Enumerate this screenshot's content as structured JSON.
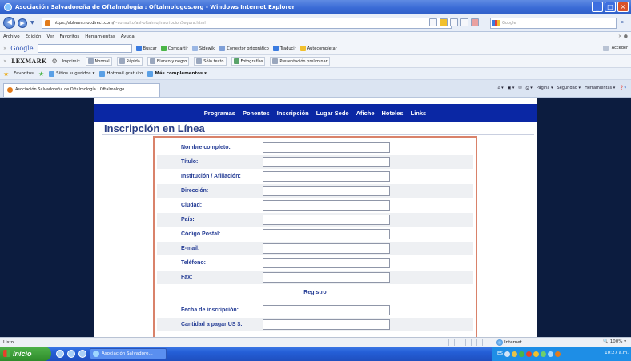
{
  "window": {
    "title": "Asociación Salvadoreña de Oftalmología : Oftalmologos.org - Windows Internet Explorer",
    "controls": [
      "_",
      "□",
      "×"
    ]
  },
  "address": {
    "host": "https://abheen.nocdirect.com/",
    "path": "~consulto/asl-oftalmo/inscripcionSegura.html",
    "search_placeholder": "Google"
  },
  "menu": {
    "items": [
      "Archivo",
      "Edición",
      "Ver",
      "Favoritos",
      "Herramientas",
      "Ayuda"
    ]
  },
  "google_toolbar": {
    "logo": "Google",
    "items": [
      "Buscar",
      "Compartir",
      "Sidewiki",
      "Corrector ortográfico",
      "Traducir",
      "Autocompletar"
    ],
    "signin": "Acceder"
  },
  "lexmark_toolbar": {
    "logo": "LEXMARK",
    "print": "Imprimir:",
    "buttons": [
      "Normal",
      "Rápida",
      "Blanco y negro",
      "Sólo texto",
      "Fotografías",
      "Presentación preliminar"
    ]
  },
  "favorites": {
    "label": "Favoritos",
    "items": [
      "Sitios sugeridos",
      "Hotmail gratuito",
      "Más complementos"
    ]
  },
  "tab": {
    "title": "Asociación Salvadoreña de Oftalmología : Oftalmologo..."
  },
  "command_bar": {
    "page": "Página",
    "security": "Seguridad",
    "tools": "Herramientas"
  },
  "site": {
    "nav": [
      "Programas",
      "Ponentes",
      "Inscripción",
      "Lugar Sede",
      "Afiche",
      "Hoteles",
      "Links"
    ],
    "heading": "Inscripción en Línea",
    "fields": [
      {
        "label": "Nombre completo:",
        "value": ""
      },
      {
        "label": "Título:",
        "value": ""
      },
      {
        "label": "Institución / Afiliación:",
        "value": ""
      },
      {
        "label": "Dirección:",
        "value": ""
      },
      {
        "label": "Ciudad:",
        "value": ""
      },
      {
        "label": "País:",
        "value": ""
      },
      {
        "label": "Código Postal:",
        "value": ""
      },
      {
        "label": "E-mail:",
        "value": ""
      },
      {
        "label": "Teléfono:",
        "value": ""
      },
      {
        "label": "Fax:",
        "value": ""
      }
    ],
    "registro_title": "Registro",
    "registro_fields": [
      {
        "label": "Fecha de inscripción:",
        "value": ""
      },
      {
        "label": "Cantidad a pagar US $:",
        "value": ""
      }
    ],
    "colors": {
      "nav_bg": "#0a27a4",
      "side_bg": "#0c1c3f",
      "label": "#243c95",
      "frame": "#d9826a"
    }
  },
  "status": {
    "text": "Listo",
    "zone": "Internet",
    "zoom": "100%"
  },
  "taskbar": {
    "start": "Inicio",
    "task": "Asociación Salvadore...",
    "lang": "ES",
    "clock": "10:27 a.m."
  }
}
